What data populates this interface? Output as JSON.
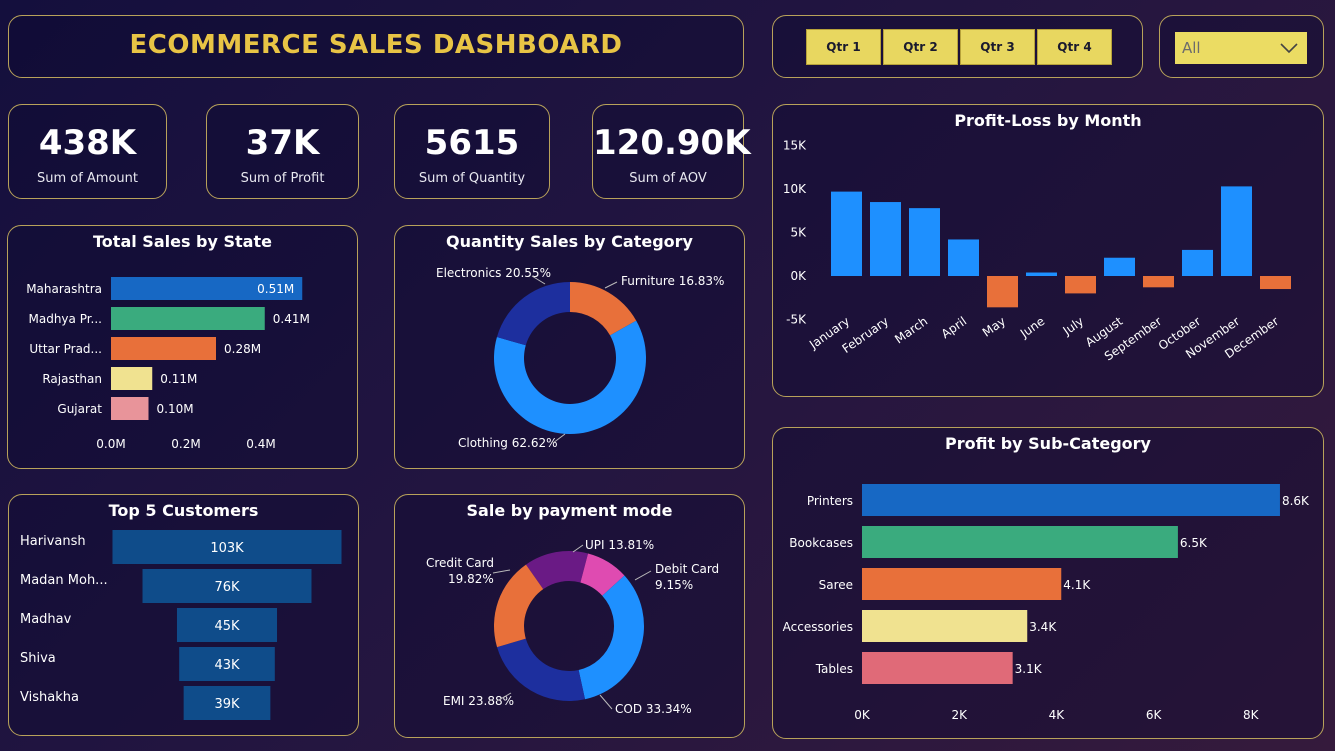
{
  "header": {
    "title": "ECOMMERCE SALES DASHBOARD"
  },
  "quarters": [
    "Qtr 1",
    "Qtr 2",
    "Qtr 3",
    "Qtr 4"
  ],
  "dropdown": {
    "selected": "All"
  },
  "kpis": [
    {
      "value": "438K",
      "label": "Sum of Amount"
    },
    {
      "value": "37K",
      "label": "Sum of Profit"
    },
    {
      "value": "5615",
      "label": "Sum of Quantity"
    },
    {
      "value": "120.90K",
      "label": "Sum of AOV"
    }
  ],
  "colors": {
    "blue": "#1e90ff",
    "orange": "#e8703a",
    "green": "#3aab7e",
    "yellow": "#f0e290",
    "pink": "#e8949a",
    "darkblue": "#1d2f9e",
    "purple": "#6a1a85",
    "magenta": "#df4bb1",
    "custblue": "#0f4c8a",
    "printers": "#1768c4",
    "tables": "#e06a78"
  },
  "chart_data": [
    {
      "id": "state",
      "type": "bar",
      "orientation": "horizontal",
      "title": "Total Sales by State",
      "categories": [
        "Maharashtra",
        "Madhya Pr...",
        "Uttar Prad...",
        "Rajasthan",
        "Gujarat"
      ],
      "values": [
        0.51,
        0.41,
        0.28,
        0.11,
        0.1
      ],
      "data_labels": [
        "0.51M",
        "0.41M",
        "0.28M",
        "0.11M",
        "0.10M"
      ],
      "bar_colors": [
        "#1768c4",
        "#3aab7e",
        "#e8703a",
        "#f0e290",
        "#e8949a"
      ],
      "x_ticks": [
        "0.0M",
        "0.2M",
        "0.4M"
      ],
      "xlim": [
        0,
        0.55
      ]
    },
    {
      "id": "category",
      "type": "pie",
      "donut": true,
      "title": "Quantity Sales by Category",
      "categories": [
        "Clothing",
        "Electronics",
        "Furniture"
      ],
      "values": [
        62.62,
        20.55,
        16.83
      ],
      "labels": [
        "Clothing 62.62%",
        "Electronics 20.55%",
        "Furniture 16.83%"
      ],
      "slice_colors": [
        "#1e90ff",
        "#1d2f9e",
        "#e8703a"
      ]
    },
    {
      "id": "month",
      "type": "bar",
      "title": "Profit-Loss by Month",
      "categories": [
        "January",
        "February",
        "March",
        "April",
        "May",
        "June",
        "July",
        "August",
        "September",
        "October",
        "November",
        "December"
      ],
      "values": [
        9.7,
        8.5,
        7.8,
        4.2,
        -3.6,
        0.4,
        -2.0,
        2.1,
        -1.3,
        3.0,
        10.3,
        -1.5
      ],
      "y_ticks": [
        "15K",
        "10K",
        "5K",
        "0K",
        "-5K"
      ],
      "ylim": [
        -5,
        15
      ]
    },
    {
      "id": "customers",
      "type": "bar",
      "orientation": "funnel",
      "title": "Top 5 Customers",
      "categories": [
        "Harivansh",
        "Madan Moh...",
        "Madhav",
        "Shiva",
        "Vishakha"
      ],
      "values": [
        103,
        76,
        45,
        43,
        39
      ],
      "data_labels": [
        "103K",
        "76K",
        "45K",
        "43K",
        "39K"
      ]
    },
    {
      "id": "payment",
      "type": "pie",
      "donut": true,
      "title": "Sale by payment mode",
      "categories": [
        "COD",
        "EMI",
        "Credit Card",
        "UPI",
        "Debit Card"
      ],
      "values": [
        33.34,
        23.88,
        19.82,
        13.81,
        9.15
      ],
      "labels": [
        [
          "COD 33.34%"
        ],
        [
          "EMI 23.88%"
        ],
        [
          "Credit Card",
          "19.82%"
        ],
        [
          "UPI 13.81%"
        ],
        [
          "Debit Card",
          "9.15%"
        ]
      ],
      "slice_colors": [
        "#1e90ff",
        "#1d2f9e",
        "#e8703a",
        "#6a1a85",
        "#df4bb1"
      ]
    },
    {
      "id": "subcategory",
      "type": "bar",
      "orientation": "horizontal",
      "title": "Profit by Sub-Category",
      "categories": [
        "Printers",
        "Bookcases",
        "Saree",
        "Accessories",
        "Tables"
      ],
      "values": [
        8.6,
        6.5,
        4.1,
        3.4,
        3.1
      ],
      "data_labels": [
        "8.6K",
        "6.5K",
        "4.1K",
        "3.4K",
        "3.1K"
      ],
      "bar_colors": [
        "#1768c4",
        "#3aab7e",
        "#e8703a",
        "#f0e290",
        "#e06a78"
      ],
      "x_ticks": [
        "0K",
        "2K",
        "4K",
        "6K",
        "8K"
      ],
      "xlim": [
        0,
        8.6
      ]
    }
  ]
}
